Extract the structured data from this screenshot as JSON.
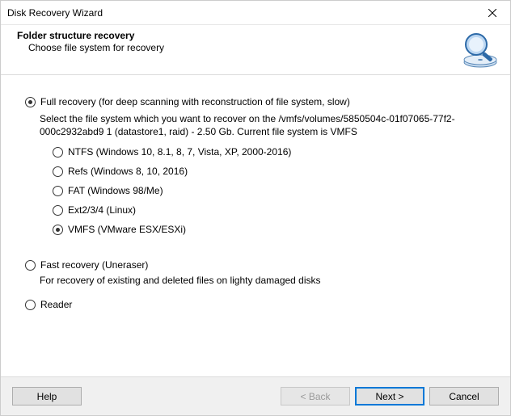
{
  "window": {
    "title": "Disk Recovery Wizard"
  },
  "header": {
    "main": "Folder structure recovery",
    "sub": "Choose file system for recovery"
  },
  "mode": {
    "full": {
      "label": "Full recovery (for deep scanning with reconstruction of file system, slow)",
      "desc": "Select the file system which you want to recover on the /vmfs/volumes/5850504c-01f07065-77f2-000c2932abd9 1 (datastore1, raid) - 2.50 Gb. Current file system is VMFS",
      "fs": {
        "ntfs": "NTFS (Windows 10, 8.1, 8, 7, Vista, XP, 2000-2016)",
        "refs": "Refs (Windows 8, 10, 2016)",
        "fat": "FAT (Windows 98/Me)",
        "ext": "Ext2/3/4 (Linux)",
        "vmfs": "VMFS (VMware ESX/ESXi)"
      }
    },
    "fast": {
      "label": "Fast recovery (Uneraser)",
      "desc": "For recovery of existing and deleted files on lighty damaged disks"
    },
    "reader": {
      "label": "Reader"
    }
  },
  "footer": {
    "help": "Help",
    "back": "< Back",
    "next": "Next >",
    "cancel": "Cancel"
  }
}
